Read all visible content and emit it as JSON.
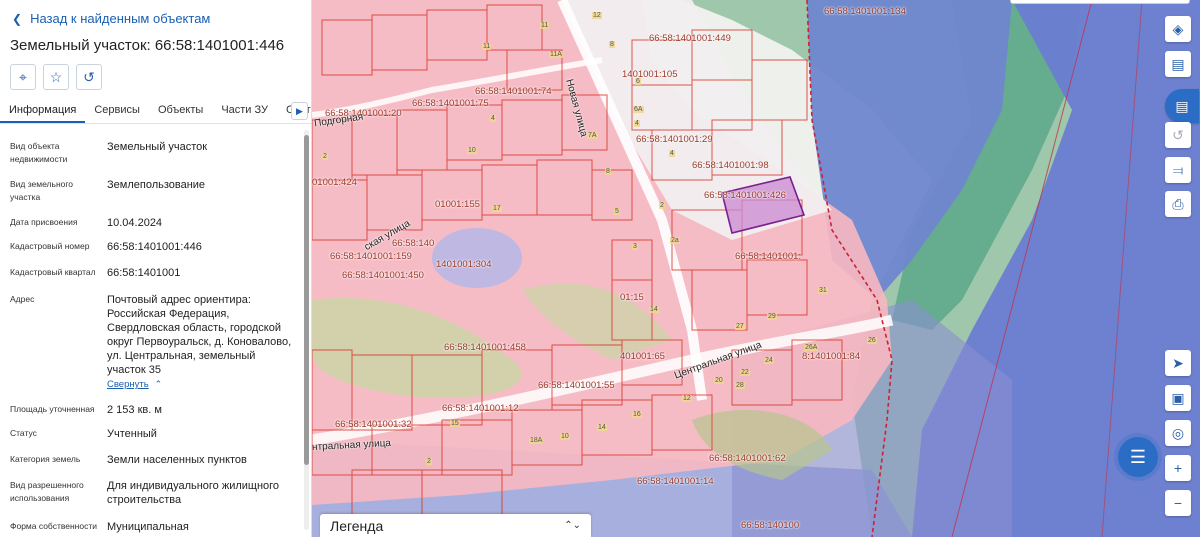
{
  "panel": {
    "back_label": "Назад к найденным объектам",
    "title": "Земельный участок: 66:58:1401001:446",
    "tabs": [
      {
        "label": "Информация"
      },
      {
        "label": "Сервисы"
      },
      {
        "label": "Объекты"
      },
      {
        "label": "Части ЗУ"
      },
      {
        "label": "Состав"
      }
    ],
    "rows": [
      {
        "label": "Вид объекта недвижимости",
        "value": "Земельный участок"
      },
      {
        "label": "Вид земельного участка",
        "value": "Землепользование"
      },
      {
        "label": "Дата присвоения",
        "value": "10.04.2024"
      },
      {
        "label": "Кадастровый номер",
        "value": "66:58:1401001:446"
      },
      {
        "label": "Кадастровый квартал",
        "value": "66:58:1401001"
      },
      {
        "label": "Адрес",
        "value": "Почтовый адрес ориентира: Российская Федерация, Свердловская область, городской округ Первоуральск, д. Коновалово, ул. Центральная, земельный участок 35"
      },
      {
        "label": "Площадь уточненная",
        "value": "2 153 кв. м"
      },
      {
        "label": "Статус",
        "value": "Учтенный"
      },
      {
        "label": "Категория земель",
        "value": "Земли населенных пунктов"
      },
      {
        "label": "Вид разрешенного использования",
        "value": "Для индивидуального жилищного строительства"
      },
      {
        "label": "Форма собственности",
        "value": "Муниципальная"
      }
    ],
    "collapse_label": "Свернуть"
  },
  "map": {
    "parcel_labels": [
      "66:58:1401001:134",
      "66:58:1401001:449",
      "1401001:105",
      "66:58:1401001:74",
      "66:58:1401001:75",
      "66:58:1401001:20",
      "66:58:1401001:29",
      "66:58:1401001:98",
      "66:58:1401001:426",
      "01001:424",
      "01001:155",
      "66:58:140",
      "66:58:1401001:159",
      "1401001:304",
      "66:58:1401001:450",
      "66:58:1401001:",
      "01:15",
      "66:58:1401001:458",
      "401001:65",
      "8:1401001:84",
      "66:58:1401001:55",
      "66:58:1401001:12",
      "66:58:1401001:32",
      "66:58:1401001:62",
      "66:58:1401001:14",
      "66:58:140100"
    ],
    "house_numbers": [
      "12",
      "11",
      "11А",
      "8",
      "6",
      "4",
      "11",
      "6А",
      "4",
      "7А",
      "10",
      "4",
      "8",
      "2",
      "2",
      "5",
      "3",
      "2а",
      "17",
      "14",
      "31",
      "29",
      "27",
      "26",
      "26А",
      "24",
      "22",
      "28",
      "20",
      "15",
      "14",
      "18А",
      "10",
      "16",
      "12",
      "2"
    ],
    "streets": [
      "Подгорная",
      "Новая улица",
      "Центральная улица",
      "нтральная улица",
      "ская улица"
    ],
    "colors": {
      "base": "#eeeff0",
      "pink_zone": "#f5b9c3",
      "parcel_border": "#d9392d",
      "green_zone": "#6aae8a",
      "blue_zone": "#6b7fd6",
      "selected": "#c98ad0"
    }
  },
  "legend": {
    "label": "Легенда"
  },
  "icons": [
    "layers-icon",
    "ruler-icon",
    "map-mode-icon",
    "history-icon",
    "share-icon",
    "print-icon",
    "locate-icon",
    "pano-icon",
    "target-icon",
    "zoom-in-icon",
    "zoom-out-icon",
    "chat-icon"
  ]
}
